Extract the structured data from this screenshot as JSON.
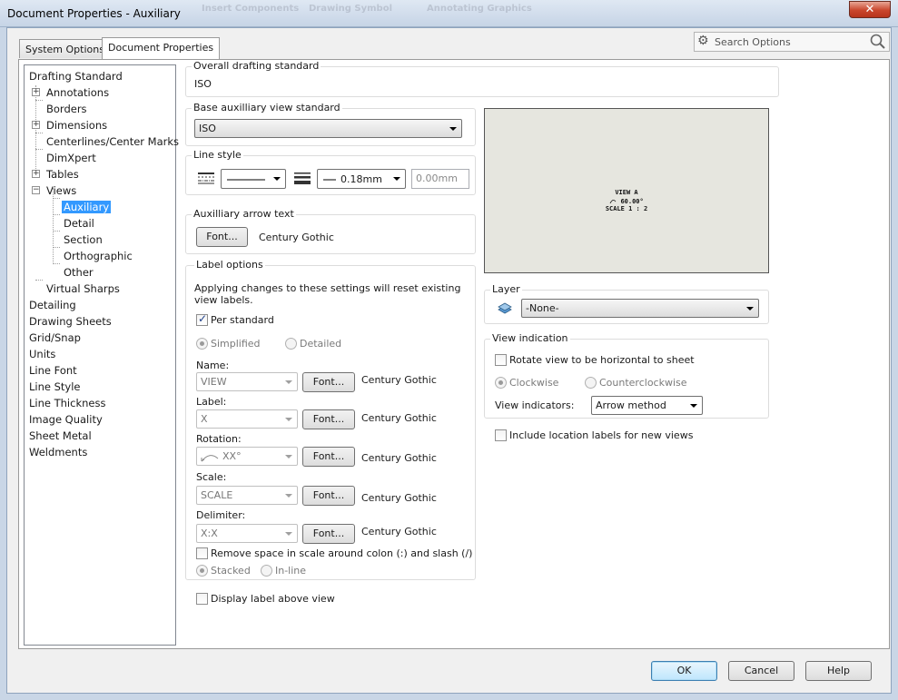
{
  "window": {
    "title": "Document Properties - Auxiliary",
    "background_ghosts": [
      "Insert Components",
      "Drawing Symbol",
      "Annotating Graphics"
    ]
  },
  "tabs": [
    {
      "label": "System Options",
      "active": false
    },
    {
      "label": "Document Properties",
      "active": true
    }
  ],
  "search": {
    "placeholder": "Search Options"
  },
  "tree": {
    "items": [
      {
        "label": "Drafting Standard"
      },
      {
        "label": "Annotations",
        "expander": "+"
      },
      {
        "label": "Borders"
      },
      {
        "label": "Dimensions",
        "expander": "+"
      },
      {
        "label": "Centerlines/Center Marks"
      },
      {
        "label": "DimXpert"
      },
      {
        "label": "Tables",
        "expander": "+"
      },
      {
        "label": "Views",
        "expander": "-"
      },
      {
        "label": "Auxiliary",
        "selected": true
      },
      {
        "label": "Detail"
      },
      {
        "label": "Section"
      },
      {
        "label": "Orthographic"
      },
      {
        "label": "Other"
      },
      {
        "label": "Virtual Sharps"
      },
      {
        "label": "Detailing"
      },
      {
        "label": "Drawing Sheets"
      },
      {
        "label": "Grid/Snap"
      },
      {
        "label": "Units"
      },
      {
        "label": "Line Font"
      },
      {
        "label": "Line Style"
      },
      {
        "label": "Line Thickness"
      },
      {
        "label": "Image Quality"
      },
      {
        "label": "Sheet Metal"
      },
      {
        "label": "Weldments"
      }
    ]
  },
  "overall": {
    "label": "Overall drafting standard",
    "value": "ISO"
  },
  "base_view": {
    "label": "Base auxilliary view standard",
    "value": "ISO"
  },
  "line_style": {
    "label": "Line style",
    "thickness": "0.18mm",
    "custom": "0.00mm"
  },
  "arrow_text": {
    "label": "Auxilliary arrow text",
    "font_button": "Font...",
    "font_name": "Century Gothic"
  },
  "label_options": {
    "label": "Label options",
    "note_line1": "Applying changes to these settings will reset existing",
    "note_line2": "view labels.",
    "per_standard": "Per standard",
    "simplified": "Simplified",
    "detailed": "Detailed",
    "rows": [
      {
        "label": "Name:",
        "value": "VIEW",
        "font_button": "Font...",
        "font_name": "Century Gothic"
      },
      {
        "label": "Label:",
        "value": "X",
        "font_button": "Font...",
        "font_name": "Century Gothic"
      },
      {
        "label": "Rotation:",
        "value": "XX°",
        "font_button": "Font...",
        "font_name": "Century Gothic"
      },
      {
        "label": "Scale:",
        "value": "SCALE",
        "font_button": "Font...",
        "font_name": "Century Gothic"
      },
      {
        "label": "Delimiter:",
        "value": "X:X",
        "font_button": "Font...",
        "font_name": "Century Gothic"
      }
    ],
    "remove_space": "Remove space in scale around colon (:) and slash (/)",
    "stacked": "Stacked",
    "inline": "In-line"
  },
  "display_above": "Display label above view",
  "preview": {
    "line1": "VIEW A",
    "line2": "60.00°",
    "line3": "SCALE 1 : 2"
  },
  "layer": {
    "label": "Layer",
    "value": "-None-"
  },
  "view_indication": {
    "label": "View indication",
    "rotate": "Rotate view to be horizontal to sheet",
    "clockwise": "Clockwise",
    "counterclockwise": "Counterclockwise",
    "indicators_label": "View indicators:",
    "indicators_value": "Arrow method"
  },
  "include_location": "Include location labels for new views",
  "footer": {
    "ok": "OK",
    "cancel": "Cancel",
    "help": "Help"
  }
}
